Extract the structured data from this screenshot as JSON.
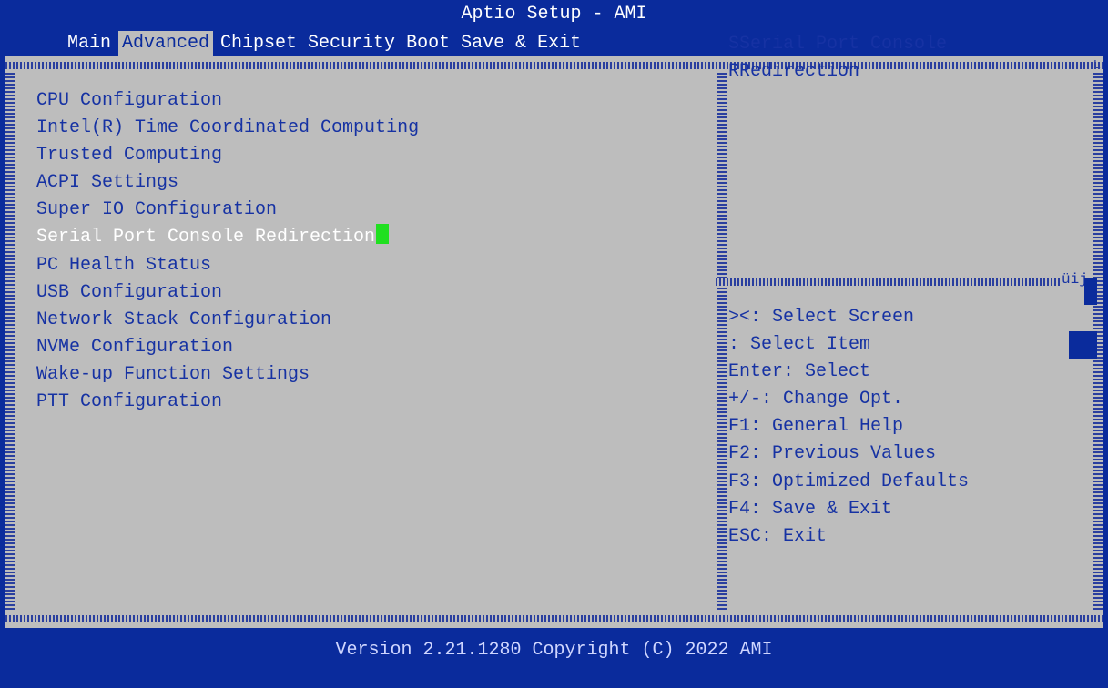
{
  "app_title": "Aptio Setup - AMI",
  "tabs": [
    {
      "label": "Main"
    },
    {
      "label": "Advanced",
      "active": true
    },
    {
      "label": "Chipset"
    },
    {
      "label": "Security"
    },
    {
      "label": "Boot"
    },
    {
      "label": "Save & Exit"
    }
  ],
  "menu": {
    "items": [
      {
        "label": "CPU Configuration"
      },
      {
        "label": "Intel(R) Time Coordinated Computing"
      },
      {
        "label": "Trusted Computing"
      },
      {
        "label": "ACPI Settings"
      },
      {
        "label": "Super IO Configuration"
      },
      {
        "label": "Serial Port Console Redirection",
        "selected": true
      },
      {
        "label": "PC Health Status"
      },
      {
        "label": "USB Configuration"
      },
      {
        "label": "Network Stack Configuration"
      },
      {
        "label": "NVMe Configuration"
      },
      {
        "label": "Wake-up Function Settings"
      },
      {
        "label": "PTT Configuration"
      }
    ]
  },
  "help": {
    "line1": "SSerial Port Console",
    "line2": "RRedirection",
    "separator_glyph": "üij",
    "top_right_glyph": "L"
  },
  "keys": [
    "><: Select Screen",
    ": Select Item",
    "Enter: Select",
    "+/-: Change Opt.",
    "F1: General Help",
    "F2: Previous Values",
    "F3: Optimized Defaults",
    "F4: Save & Exit",
    "ESC: Exit"
  ],
  "footer": "Version 2.21.1280 Copyright (C) 2022 AMI",
  "colors": {
    "background": "#0a2b9c",
    "panel": "#bdbdbd",
    "text": "#1632a3",
    "highlight_text": "#ffffff",
    "cursor": "#20e020"
  }
}
